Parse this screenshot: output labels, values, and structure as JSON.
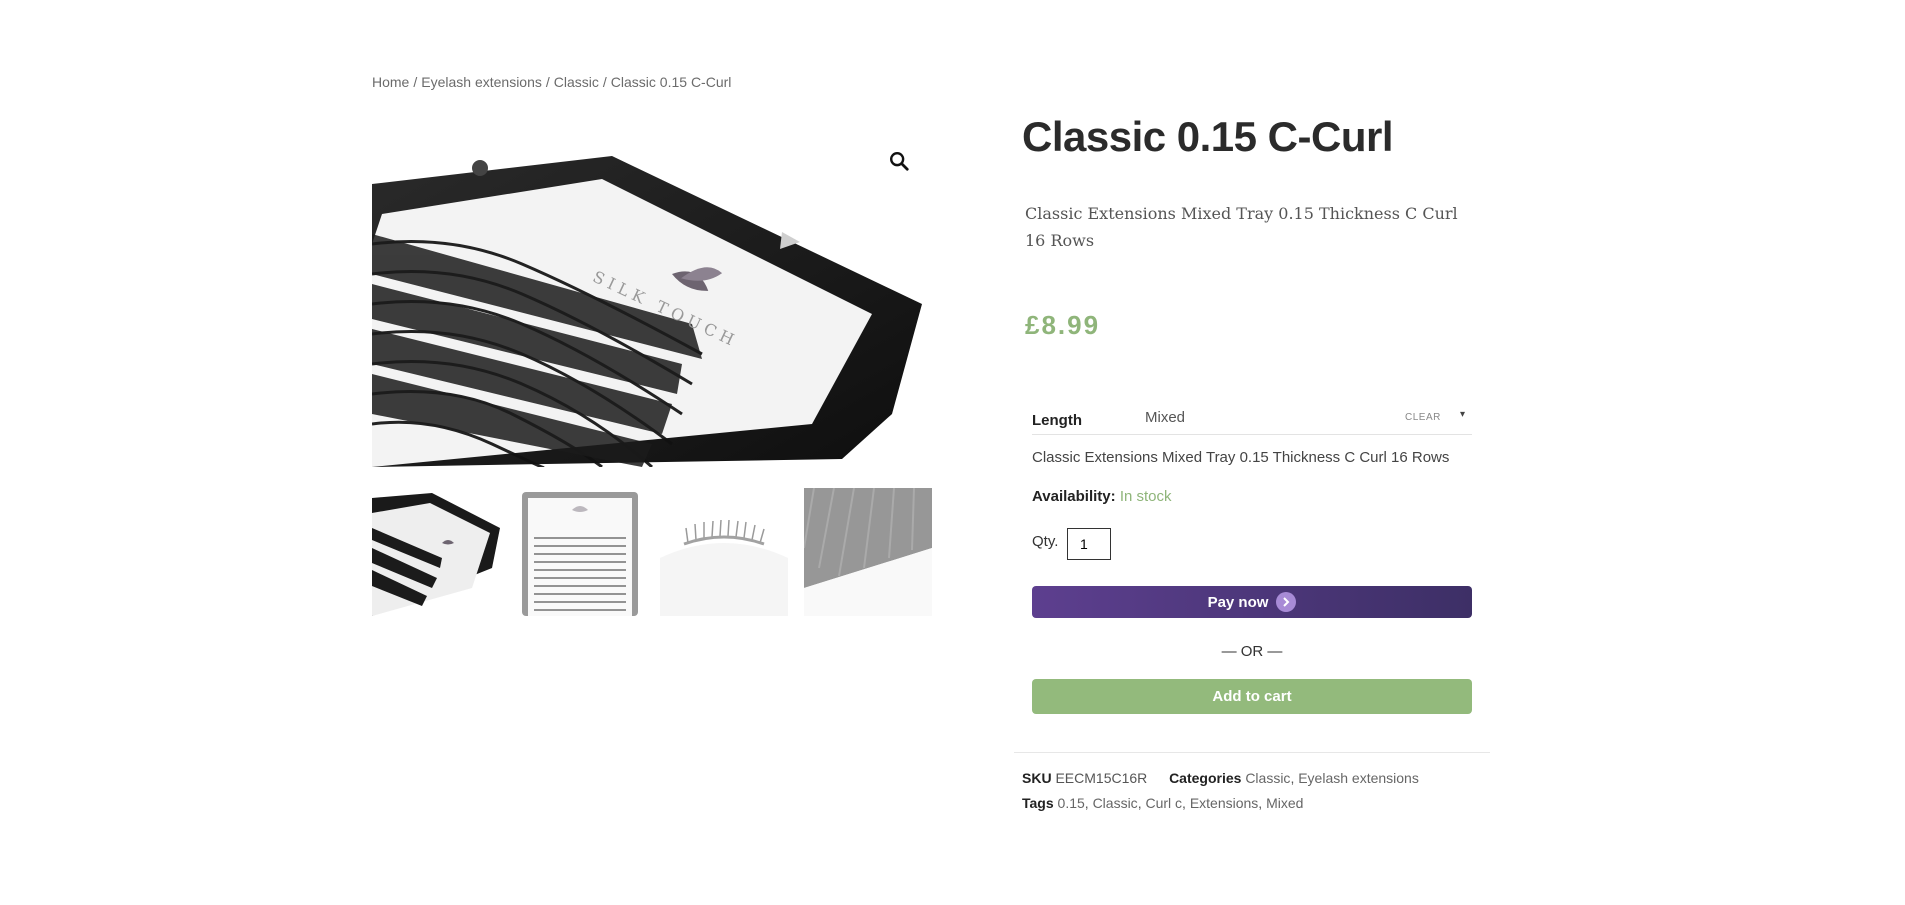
{
  "breadcrumb": {
    "home": "Home",
    "cat1": "Eyelash extensions",
    "cat2": "Classic",
    "current": "Classic 0.15 C-Curl",
    "separator": "/"
  },
  "gallery": {
    "brand_text": "SILK TOUCH",
    "zoom_icon": "search-icon"
  },
  "product": {
    "title": "Classic 0.15 C-Curl",
    "short_description": "Classic Extensions Mixed Tray 0.15 Thickness C Curl 16 Rows",
    "price": "£8.99",
    "variation": {
      "label": "Length",
      "selected": "Mixed",
      "clear": "CLEAR",
      "arrow": "▾"
    },
    "variation_description": "Classic Extensions Mixed Tray 0.15 Thickness C Curl 16 Rows",
    "availability_label": "Availability:",
    "availability_value": "In stock",
    "qty_label": "Qty.",
    "qty_value": "1",
    "pay_now": "Pay now",
    "or_text": "— OR —",
    "add_to_cart": "Add to cart"
  },
  "meta": {
    "sku_label": "SKU",
    "sku_value": "EECM15C16R",
    "categories_label": "Categories",
    "categories": [
      "Classic",
      "Eyelash extensions"
    ],
    "tags_label": "Tags",
    "tags": [
      "0.15",
      "Classic",
      "Curl c",
      "Extensions",
      "Mixed"
    ]
  },
  "colors": {
    "price_green": "#8fb57a",
    "add_to_cart_green": "#93ba7c",
    "pay_now_purple": "#5d3f8f"
  }
}
